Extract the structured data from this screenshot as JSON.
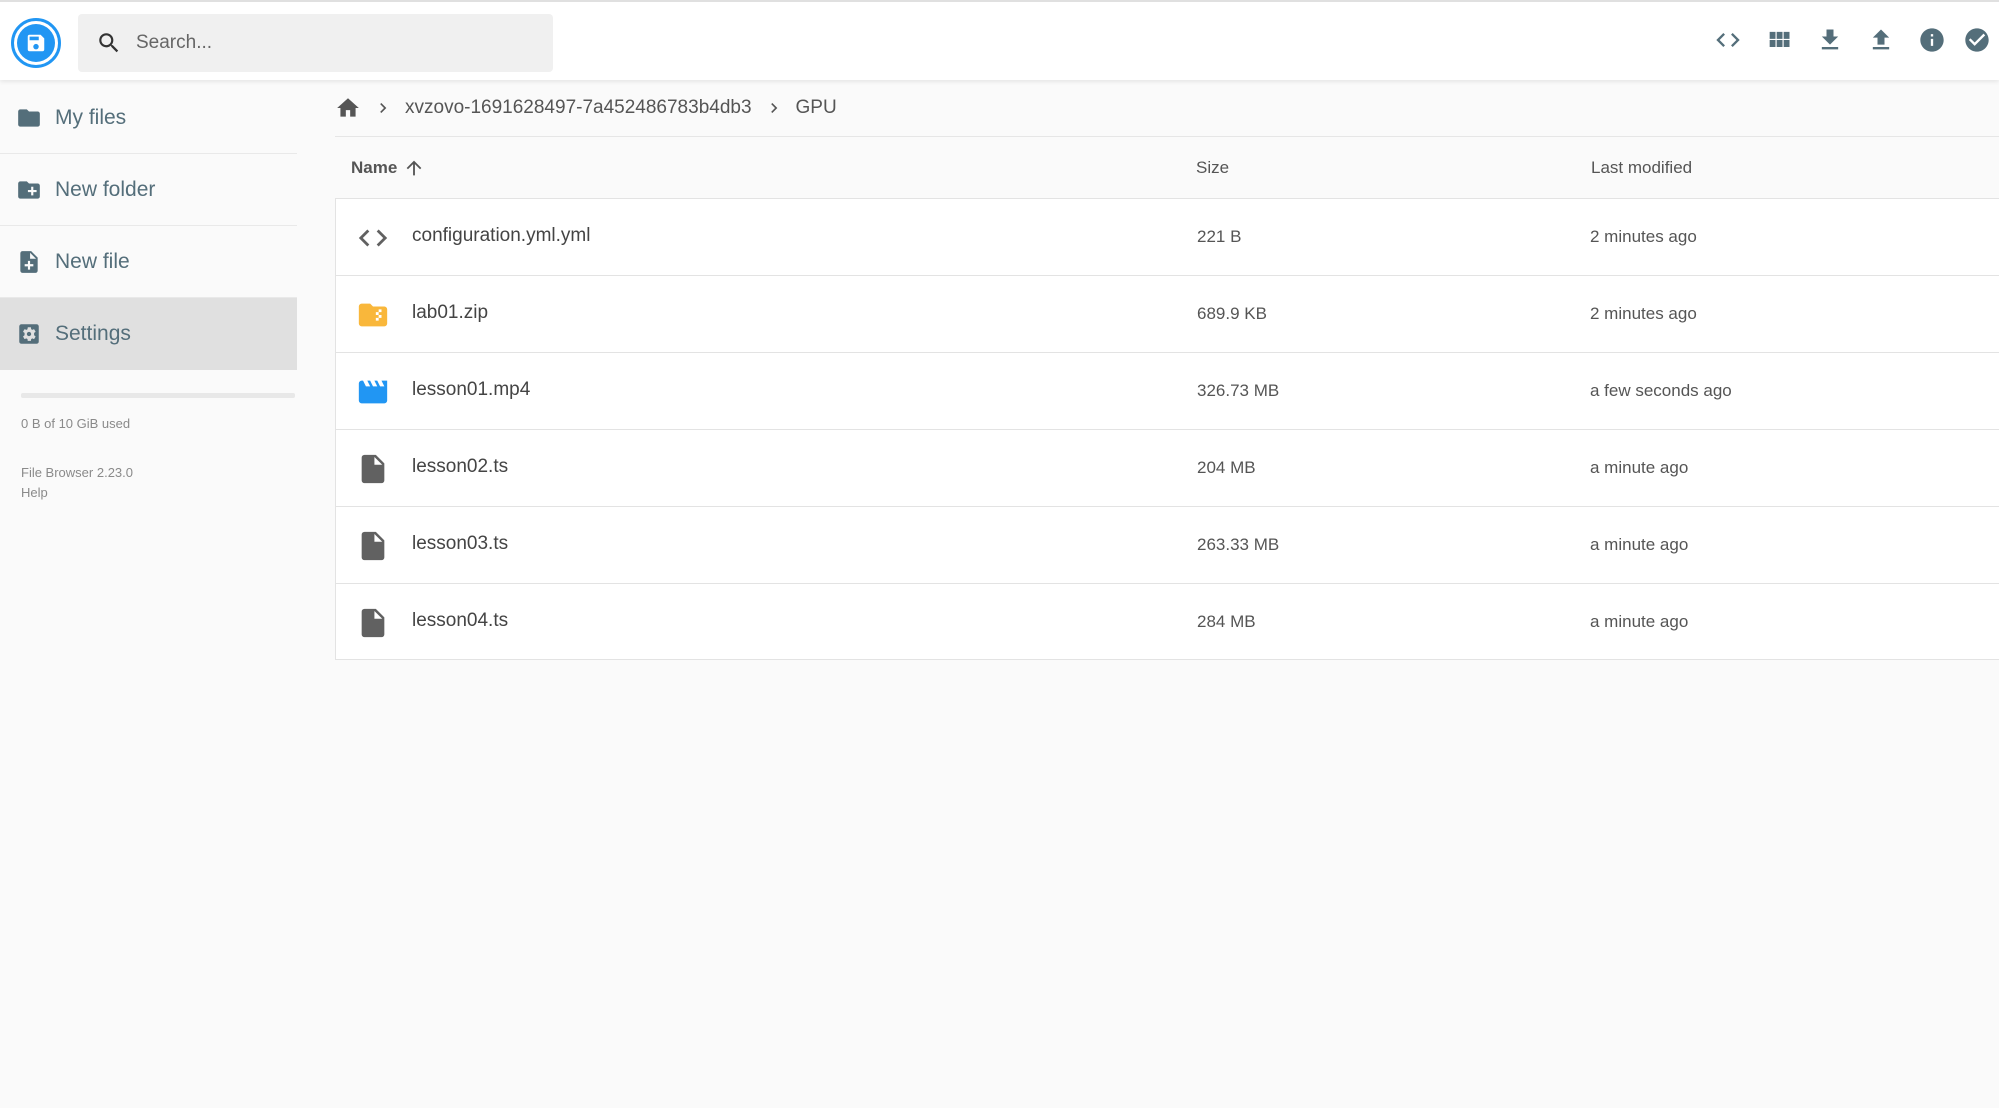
{
  "app": {
    "name": "File Browser"
  },
  "search": {
    "placeholder": "Search..."
  },
  "toolbar": {
    "buttons": [
      {
        "name": "code-view",
        "icon": "code-icon"
      },
      {
        "name": "grid-view",
        "icon": "grid-icon"
      },
      {
        "name": "download",
        "icon": "download-icon"
      },
      {
        "name": "upload",
        "icon": "upload-icon"
      },
      {
        "name": "info",
        "icon": "info-icon"
      },
      {
        "name": "select",
        "icon": "check-circle-icon"
      }
    ]
  },
  "sidebar": {
    "items": [
      {
        "label": "My files",
        "icon": "folder-icon"
      },
      {
        "label": "New folder",
        "icon": "create-new-folder-icon"
      },
      {
        "label": "New file",
        "icon": "note-add-icon"
      },
      {
        "label": "Settings",
        "icon": "settings-icon",
        "active": true
      }
    ],
    "usage_text": "0 B of 10 GiB used",
    "usage_fraction": 0,
    "version": "File Browser 2.23.0",
    "help": "Help"
  },
  "breadcrumb": {
    "home_icon": "home-icon",
    "items": [
      "xvzovo-1691628497-7a452486783b4db3",
      "GPU"
    ]
  },
  "list": {
    "headers": {
      "name": "Name",
      "size": "Size",
      "modified": "Last modified"
    },
    "sort_icon": "arrow-upward-icon",
    "rows": [
      {
        "name": "configuration.yml.yml",
        "size": "221 B",
        "modified": "2 minutes ago",
        "icon": "code-icon",
        "icon_color": "#616161"
      },
      {
        "name": "lab01.zip",
        "size": "689.9 KB",
        "modified": "2 minutes ago",
        "icon": "folder-zip-icon",
        "icon_color": "#f9b73b"
      },
      {
        "name": "lesson01.mp4",
        "size": "326.73 MB",
        "modified": "a few seconds ago",
        "icon": "movie-icon",
        "icon_color": "#2196f3"
      },
      {
        "name": "lesson02.ts",
        "size": "204 MB",
        "modified": "a minute ago",
        "icon": "file-icon",
        "icon_color": "#616161"
      },
      {
        "name": "lesson03.ts",
        "size": "263.33 MB",
        "modified": "a minute ago",
        "icon": "file-icon",
        "icon_color": "#616161"
      },
      {
        "name": "lesson04.ts",
        "size": "284 MB",
        "modified": "a minute ago",
        "icon": "file-icon",
        "icon_color": "#616161"
      }
    ]
  },
  "colors": {
    "accent": "#2196f3",
    "sidebar_text": "#546e7a",
    "active_bg": "#e0e0e0"
  }
}
